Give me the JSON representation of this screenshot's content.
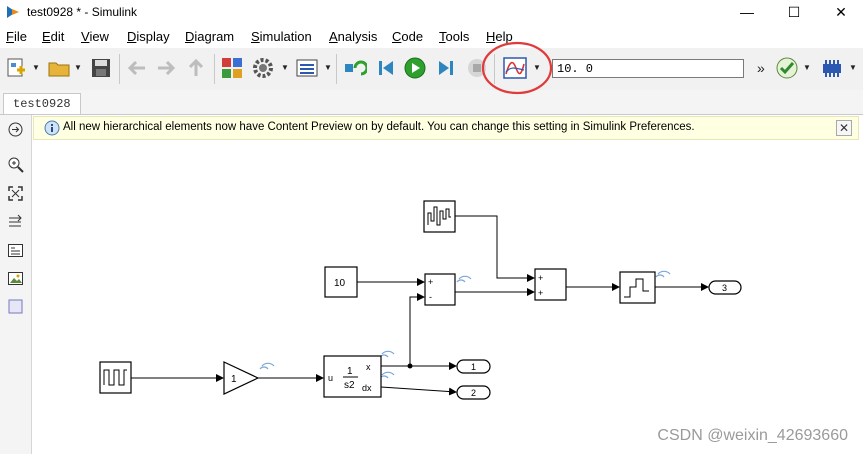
{
  "window": {
    "title": "test0928 * - Simulink",
    "minimize_glyph": "—",
    "maximize_glyph": "☐",
    "close_glyph": "✕"
  },
  "menu": [
    {
      "label": "File",
      "mnemonic": "F",
      "rest": "ile"
    },
    {
      "label": "Edit",
      "mnemonic": "E",
      "rest": "dit"
    },
    {
      "label": "View",
      "mnemonic": "V",
      "rest": "iew"
    },
    {
      "label": "Display",
      "mnemonic": "D",
      "rest": "isplay"
    },
    {
      "label": "Diagram",
      "mnemonic": "D",
      "rest": "iagram"
    },
    {
      "label": "Simulation",
      "mnemonic": "S",
      "rest": "imulation"
    },
    {
      "label": "Analysis",
      "mnemonic": "A",
      "rest": "nalysis"
    },
    {
      "label": "Code",
      "mnemonic": "C",
      "rest": "ode"
    },
    {
      "label": "Tools",
      "mnemonic": "T",
      "rest": "ools"
    },
    {
      "label": "Help",
      "mnemonic": "H",
      "rest": "elp"
    }
  ],
  "toolbar": {
    "stop_time": "10. 0",
    "overflow_glyph": "»"
  },
  "tab": {
    "label": "test0928"
  },
  "info": {
    "message": "All new hierarchical elements now have Content Preview on by default. You can change this setting in Simulink Preferences.",
    "close_glyph": "✕"
  },
  "diagram": {
    "constant_value": "10",
    "gain_value": "1",
    "sum1_signs": [
      "+",
      "-"
    ],
    "sum2_signs": [
      "+",
      "+"
    ],
    "integrator_input": "u",
    "integrator_num": "1",
    "integrator_den": "s2",
    "integrator_out1": "x",
    "integrator_out2": "dx",
    "outport1": "1",
    "outport2": "2",
    "outport3": "3"
  },
  "watermark": "CSDN @weixin_42693660",
  "colors": {
    "accent_highlight": "#e03a3a",
    "run_green": "#2ea02e",
    "info_bg": "#ffffe1"
  }
}
